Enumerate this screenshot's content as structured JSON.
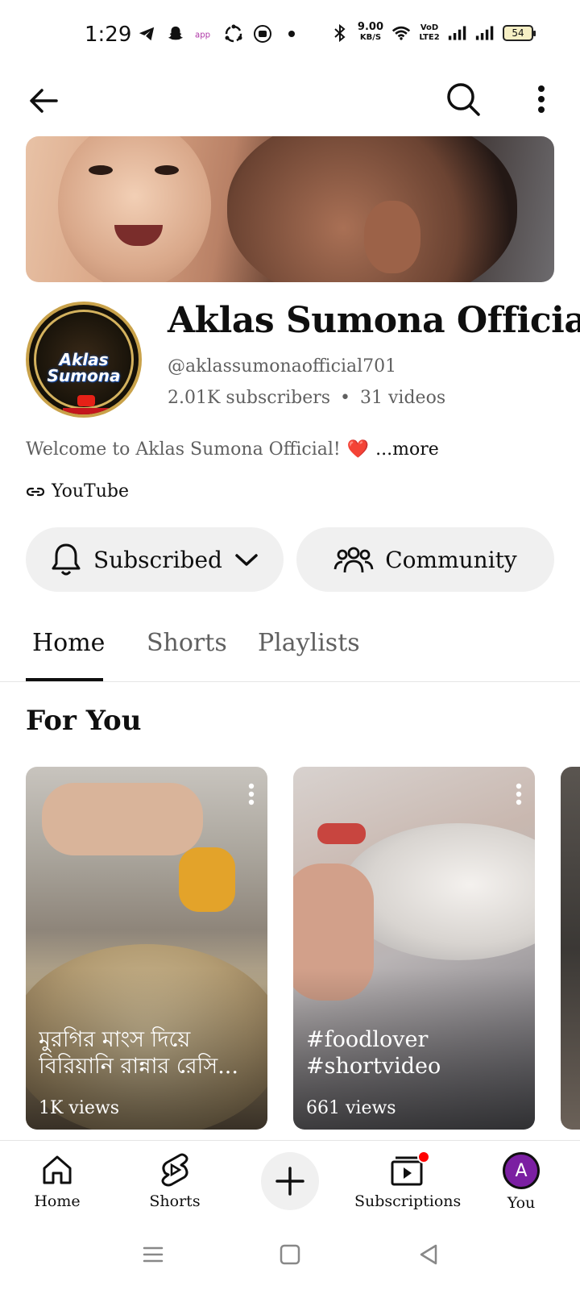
{
  "status_bar": {
    "time": "1:29",
    "network_speed_value": "9.00",
    "network_speed_unit": "KB/S",
    "volte_label": "VoD LTE2",
    "battery_level": "54",
    "icons": [
      "telegram-icon",
      "snapchat-icon",
      "app-icon",
      "sync-icon",
      "camera-icon",
      "dot-icon",
      "bluetooth-icon",
      "wifi-icon",
      "signal-icon"
    ]
  },
  "header": {
    "back_icon": "arrow-left-icon",
    "search_icon": "search-icon",
    "more_icon": "more-vertical-icon"
  },
  "channel": {
    "name": "Aklas Sumona Official",
    "handle": "@aklassumonaofficial701",
    "subscribers": "2.01K subscribers",
    "separator": "•",
    "videos": "31 videos",
    "description": "Welcome to Aklas Sumona Official!",
    "description_emoji": "❤️",
    "more_label": "...more",
    "link_label": "YouTube",
    "avatar_text_line1": "Aklas",
    "avatar_text_line2": "Sumona"
  },
  "actions": {
    "subscribed_label": "Subscribed",
    "community_label": "Community"
  },
  "tabs": [
    {
      "label": "Home",
      "active": true
    },
    {
      "label": "Shorts",
      "active": false
    },
    {
      "label": "Playlists",
      "active": false
    }
  ],
  "section": {
    "title": "For You"
  },
  "shorts": [
    {
      "title": "মুরগির মাংস দিয়ে বিরিয়ানি রান্নার রেসি...",
      "views": "1K views"
    },
    {
      "title": "#foodlover #shortvideo #vairalvideo",
      "views": "661 views"
    }
  ],
  "bottom_nav": {
    "home": "Home",
    "shorts": "Shorts",
    "subscriptions": "Subscriptions",
    "you": "You",
    "you_avatar_letter": "A"
  },
  "colors": {
    "accent_red": "#ff0000",
    "text_primary": "#0f0f0f",
    "text_secondary": "#606060",
    "button_bg": "#f0f0f0",
    "avatar_purple": "#7b1fa2"
  }
}
